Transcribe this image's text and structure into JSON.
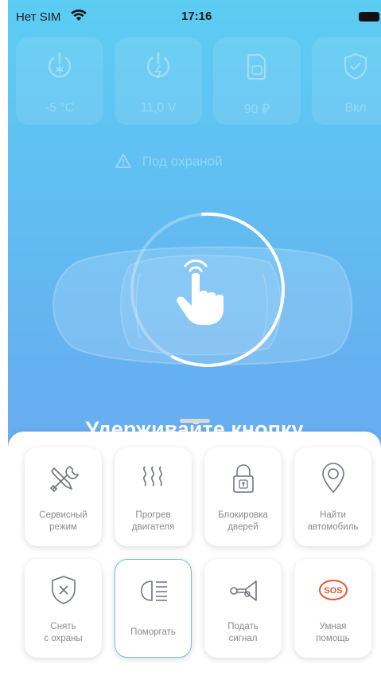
{
  "status_bar": {
    "carrier": "Нет SIM",
    "time": "17:16"
  },
  "sensors": [
    {
      "icon": "power-snowflake-icon",
      "value": "-5 °C"
    },
    {
      "icon": "power-bolt-icon",
      "value": "11,0 V"
    },
    {
      "icon": "sim-card-icon",
      "value": "90 ₽"
    },
    {
      "icon": "shield-check-icon",
      "value": "Вкл"
    }
  ],
  "guard_status": "Под охраной",
  "hold_text": "Удерживайте кнопку",
  "actions": [
    {
      "icon": "wrench-screwdriver-icon",
      "label": "Сервисный\nрежим"
    },
    {
      "icon": "heat-waves-icon",
      "label": "Прогрев\nдвигателя"
    },
    {
      "icon": "padlock-icon",
      "label": "Блокировка\nдверей"
    },
    {
      "icon": "location-pin-icon",
      "label": "Найти\nавтомобиль"
    },
    {
      "icon": "shield-x-icon",
      "label": "Снять\nс охраны"
    },
    {
      "icon": "headlight-icon",
      "label": "Поморгать"
    },
    {
      "icon": "horn-icon",
      "label": "Подать\nсигнал"
    },
    {
      "icon": "sos-icon",
      "label": "Умная\nпомощь"
    }
  ],
  "colors": {
    "gradient_top": "#5ccdf3",
    "gradient_bottom": "#76a7ee",
    "accent_icon": "#6e7480",
    "sos_red": "#e8572f",
    "selected_border": "#6ec1e4"
  }
}
